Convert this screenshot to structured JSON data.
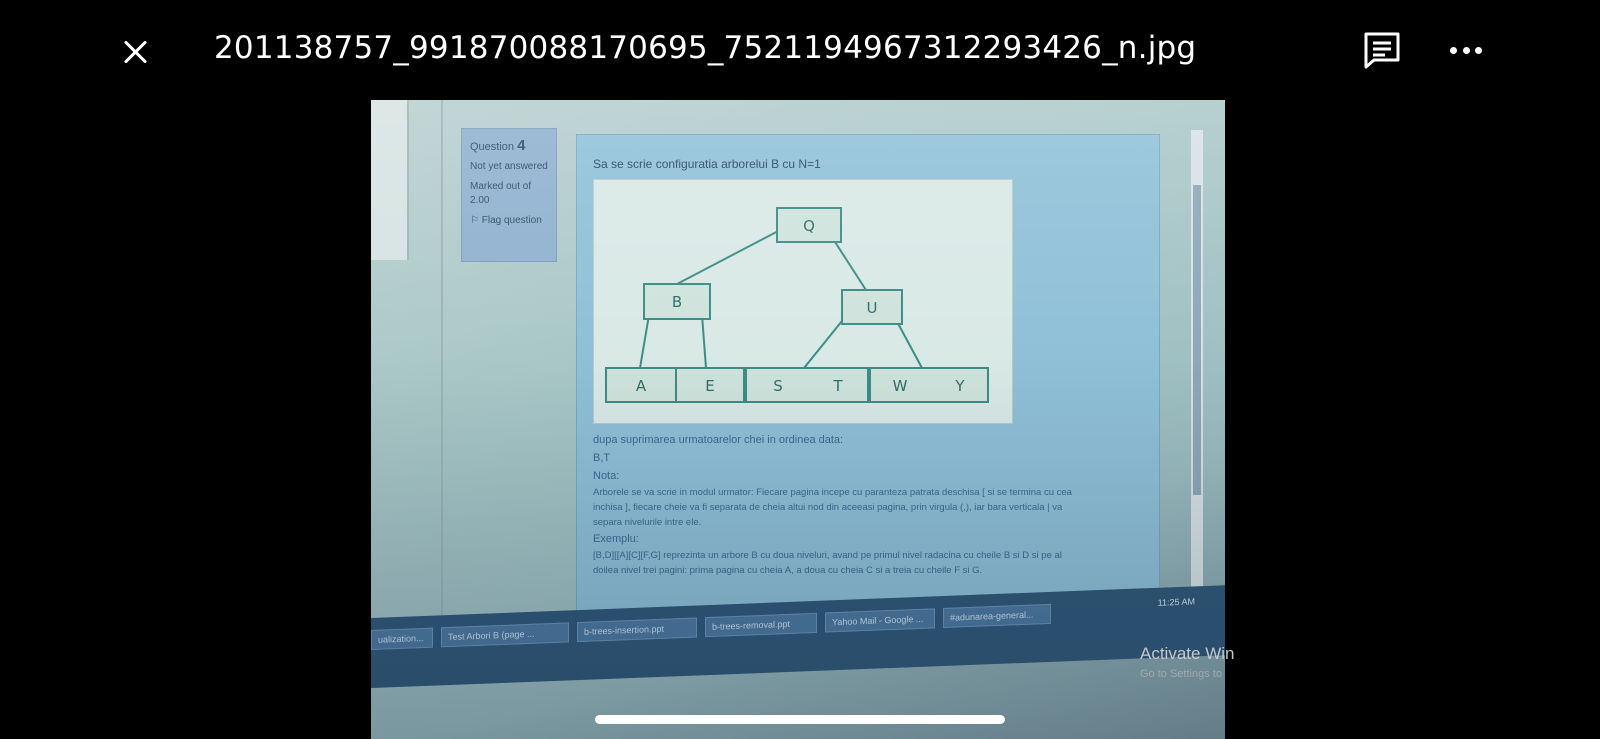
{
  "viewer": {
    "file_name": "201138757_991870088170695_752119496731229342​6_n.jpg",
    "close_icon": "close-icon",
    "comment_icon": "comment-icon",
    "more_icon": "more-horizontal-icon"
  },
  "quiz": {
    "question_label": "Question",
    "question_number": "4",
    "status": "Not yet answered",
    "marked_out_of": "Marked out of 2.00",
    "flag_label": "Flag question",
    "prompt": "Sa se scrie configuratia arborelui B cu N=1",
    "tree": {
      "root": "Q",
      "level2": [
        "B",
        "U"
      ],
      "leaves": [
        "A",
        "E",
        "S",
        "T",
        "W",
        "Y"
      ]
    },
    "after_deletion": "dupa suprimarea urmatoarelor chei in ordinea data:",
    "keys": "B,T",
    "nota_label": "Nota:",
    "nota_text_1": "Arborele se va scrie in modul urmator: Fiecare pagina incepe cu paranteza patrata deschisa [ si se termina cu cea",
    "nota_text_2": "inchisa ], fiecare cheie va fi separata de cheia altui nod din aceeasi pagina, prin virgula (,), iar bara verticala | va",
    "nota_text_3": "separa nivelurile intre ele.",
    "example_label": "Exemplu:",
    "example_text_1": "[B,D][[A][C][F,G] reprezinta un arbore B cu doua niveluri, avand pe primul nivel radacina cu cheile B si D si pe al",
    "example_text_2": "doilea nivel trei pagini: prima pagina cu cheia A, a doua cu cheia C si a treia cu cheile F si G."
  },
  "taskbar": {
    "items": [
      "ualization...",
      "Test Arbori B (page ...",
      "b-trees-insertion.ppt",
      "b-trees-removal.ppt",
      "Yahoo Mail - Google ...",
      "#adunarea-general..."
    ],
    "clock": "11:25 AM"
  },
  "watermark": {
    "title": "Activate Win",
    "subtitle": "Go to Settings to"
  }
}
